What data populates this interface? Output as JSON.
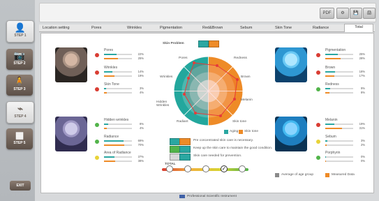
{
  "sidebar": {
    "steps": [
      {
        "label": "STEP 1",
        "icon": "user-plus-icon"
      },
      {
        "label": "STEP 2",
        "icon": "camera-icon"
      },
      {
        "label": "STEP 3",
        "icon": "person-icon"
      },
      {
        "label": "STEP 4",
        "icon": "analysis-icon"
      },
      {
        "label": "STEP 5",
        "icon": "report-icon"
      }
    ],
    "exit_label": "EXIT"
  },
  "toolbar": {
    "pdf_label": "PDF"
  },
  "tabs": [
    "Location setting",
    "Pores",
    "Wrinkles",
    "Pigmentation",
    "Red&Brown",
    "Sebum",
    "Skin Tone",
    "Radiance",
    "Total"
  ],
  "metrics": {
    "left": [
      {
        "name": "Pores",
        "v1": "22%",
        "v2": "25%"
      },
      {
        "name": "Wrinkles",
        "v1": "14%",
        "v2": "19%"
      },
      {
        "name": "Skin Tone",
        "v1": "3%",
        "v2": "4%"
      },
      {
        "name": "Hidden wrinkles",
        "v1": "8%",
        "v2": "4%"
      },
      {
        "name": "Radiance",
        "v1": "69%",
        "v2": "70%"
      },
      {
        "name": "Area of Radiance",
        "v1": "37%",
        "v2": "38%"
      }
    ],
    "right": [
      {
        "name": "Pigmentation",
        "v1": "25%",
        "v2": "28%"
      },
      {
        "name": "Brown",
        "v1": "18%",
        "v2": "17%"
      },
      {
        "name": "Redness",
        "v1": "9%",
        "v2": "8%"
      },
      {
        "name": "Melanin",
        "v1": "19%",
        "v2": "31%"
      },
      {
        "name": "Sebum",
        "v1": "3%",
        "v2": "2%"
      },
      {
        "name": "Porphyrin",
        "v1": "0%",
        "v2": "0%"
      }
    ]
  },
  "chart": {
    "title": "Skin Problem",
    "labels": [
      "Pores",
      "Redness",
      "Brown",
      "Melanin",
      "Skin tone",
      "Radiant",
      "Hidden Wrinkles",
      "Wrinkles"
    ],
    "legend": [
      "Aging",
      "Skin tone"
    ]
  },
  "messages": [
    "Pre concentrated skin care is necessary.",
    "Keep up the skin care to maintain the good condition.",
    "Skin care needed for prevention."
  ],
  "total": {
    "label": "TOTAL"
  },
  "bottom_legend": [
    "Average of age group",
    "Measured Data"
  ],
  "footer": "Professional Scientific Instrument",
  "colors": {
    "orange": "#ee8b27",
    "teal": "#2aa7a1",
    "red": "#d93d33",
    "green": "#52b44a",
    "yellow": "#e8d338"
  }
}
